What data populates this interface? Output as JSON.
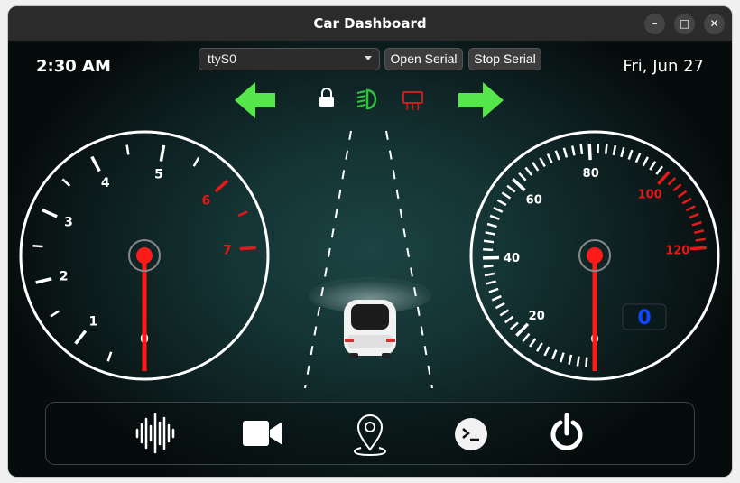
{
  "window": {
    "title": "Car Dashboard"
  },
  "header": {
    "time": "2:30 AM",
    "date": "Fri, Jun 27",
    "serial_port": "ttyS0",
    "open_serial_label": "Open Serial",
    "stop_serial_label": "Stop Serial"
  },
  "indicators": {
    "left_turn_color": "#55e64b",
    "right_turn_color": "#55e64b",
    "lock_icon": "lock-icon",
    "headlight_color": "#2ec43c",
    "defrost_color": "#c81e1e"
  },
  "tachometer": {
    "labels": [
      "0",
      "1",
      "2",
      "3",
      "4",
      "5",
      "6",
      "7"
    ],
    "redline_from": "6",
    "needle_value": 0
  },
  "speedometer": {
    "labels": [
      "0",
      "20",
      "40",
      "60",
      "80",
      "100",
      "120"
    ],
    "redline_from": "100",
    "needle_value": 0,
    "digital_speed": "0"
  },
  "bottom_bar": {
    "icons": [
      "voice-wave-icon",
      "camera-icon",
      "location-pin-icon",
      "terminal-icon",
      "power-icon"
    ]
  }
}
